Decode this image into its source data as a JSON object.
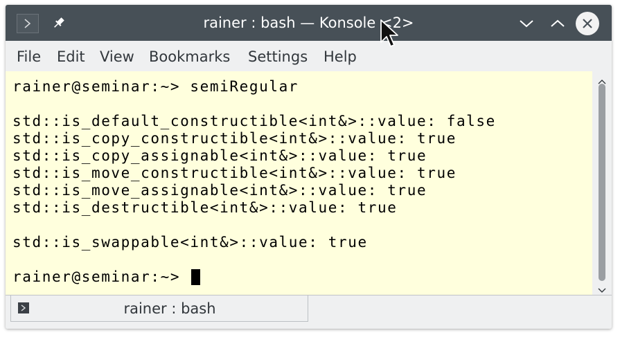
{
  "window": {
    "title": "rainer : bash — Konsole <2>",
    "titlebar_color": "#475057",
    "icons": {
      "app": "terminal-prompt-icon",
      "pin": "pin-icon",
      "minimize": "chevron-down-icon",
      "maximize": "chevron-up-icon",
      "close": "close-icon"
    }
  },
  "menubar": {
    "items": [
      {
        "label": "File"
      },
      {
        "label": "Edit"
      },
      {
        "label": "View"
      },
      {
        "label": "Bookmarks"
      },
      {
        "label": "Settings"
      },
      {
        "label": "Help"
      }
    ]
  },
  "terminal": {
    "background": "#ffffdd",
    "lines": [
      "rainer@seminar:~> semiRegular",
      "",
      "std::is_default_constructible<int&>::value: false",
      "std::is_copy_constructible<int&>::value: true",
      "std::is_copy_assignable<int&>::value: true",
      "std::is_move_constructible<int&>::value: true",
      "std::is_move_assignable<int&>::value: true",
      "std::is_destructible<int&>::value: true",
      "",
      "std::is_swappable<int&>::value: true",
      "",
      "rainer@seminar:~> "
    ]
  },
  "scrollbar": {
    "position_fraction": 1.0
  },
  "tabs": [
    {
      "label": "rainer : bash",
      "icon": "terminal-prompt-icon"
    }
  ]
}
